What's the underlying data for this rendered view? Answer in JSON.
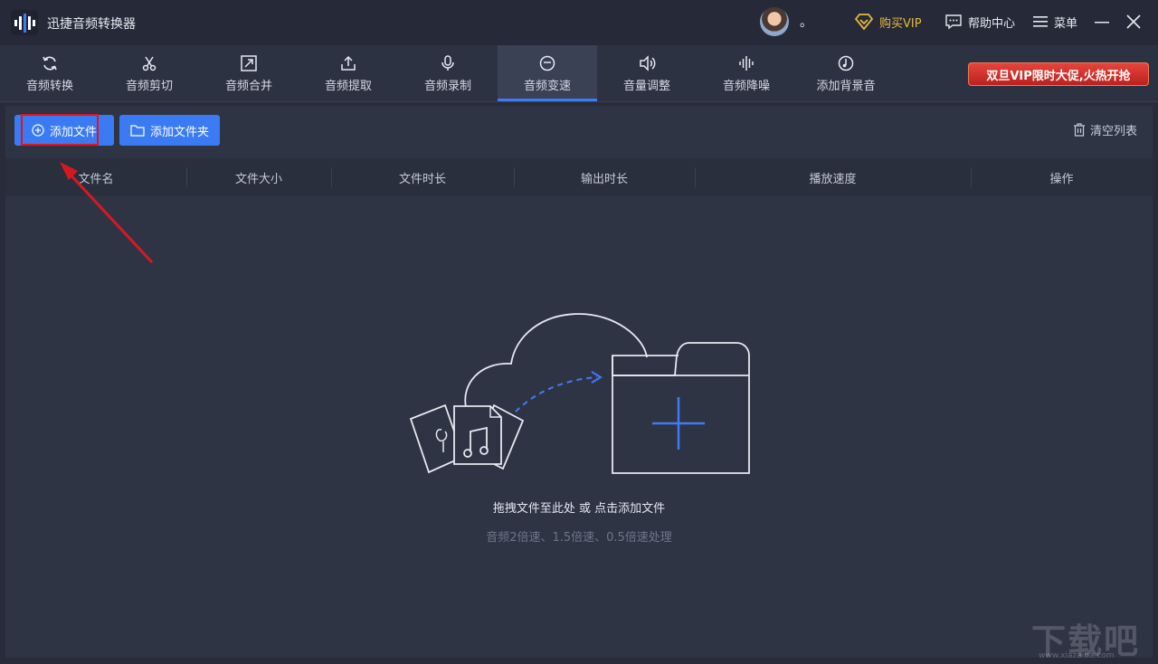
{
  "app": {
    "title": "迅捷音频转换器"
  },
  "user": {
    "name": "。"
  },
  "titlebar": {
    "vip_label": "购买VIP",
    "help_label": "帮助中心",
    "menu_label": "菜单"
  },
  "tabs": [
    {
      "label": "音频转换",
      "icon": "refresh-icon"
    },
    {
      "label": "音频剪切",
      "icon": "scissors-icon"
    },
    {
      "label": "音频合并",
      "icon": "merge-icon"
    },
    {
      "label": "音频提取",
      "icon": "upload-icon"
    },
    {
      "label": "音频录制",
      "icon": "microphone-icon"
    },
    {
      "label": "音频变速",
      "icon": "speed-icon",
      "active": true
    },
    {
      "label": "音量调整",
      "icon": "volume-icon"
    },
    {
      "label": "音频降噪",
      "icon": "waveform-icon"
    },
    {
      "label": "添加背景音",
      "icon": "music-disc-icon"
    }
  ],
  "promo": {
    "text": "双旦VIP限时大促,火热开抢"
  },
  "actions": {
    "add_file": "添加文件",
    "add_folder": "添加文件夹",
    "clear_list": "清空列表"
  },
  "table": {
    "columns": [
      "文件名",
      "文件大小",
      "文件时长",
      "输出时长",
      "播放速度",
      "操作"
    ]
  },
  "empty_state": {
    "hint": "拖拽文件至此处 或 点击添加文件",
    "sub": "音频2倍速、1.5倍速、0.5倍速处理"
  },
  "watermark": {
    "text": "下载吧",
    "url": "www.xiazaiba.com"
  },
  "colors": {
    "accent": "#3a7bf3",
    "vip": "#e8b93f",
    "highlight": "#e2141c"
  }
}
